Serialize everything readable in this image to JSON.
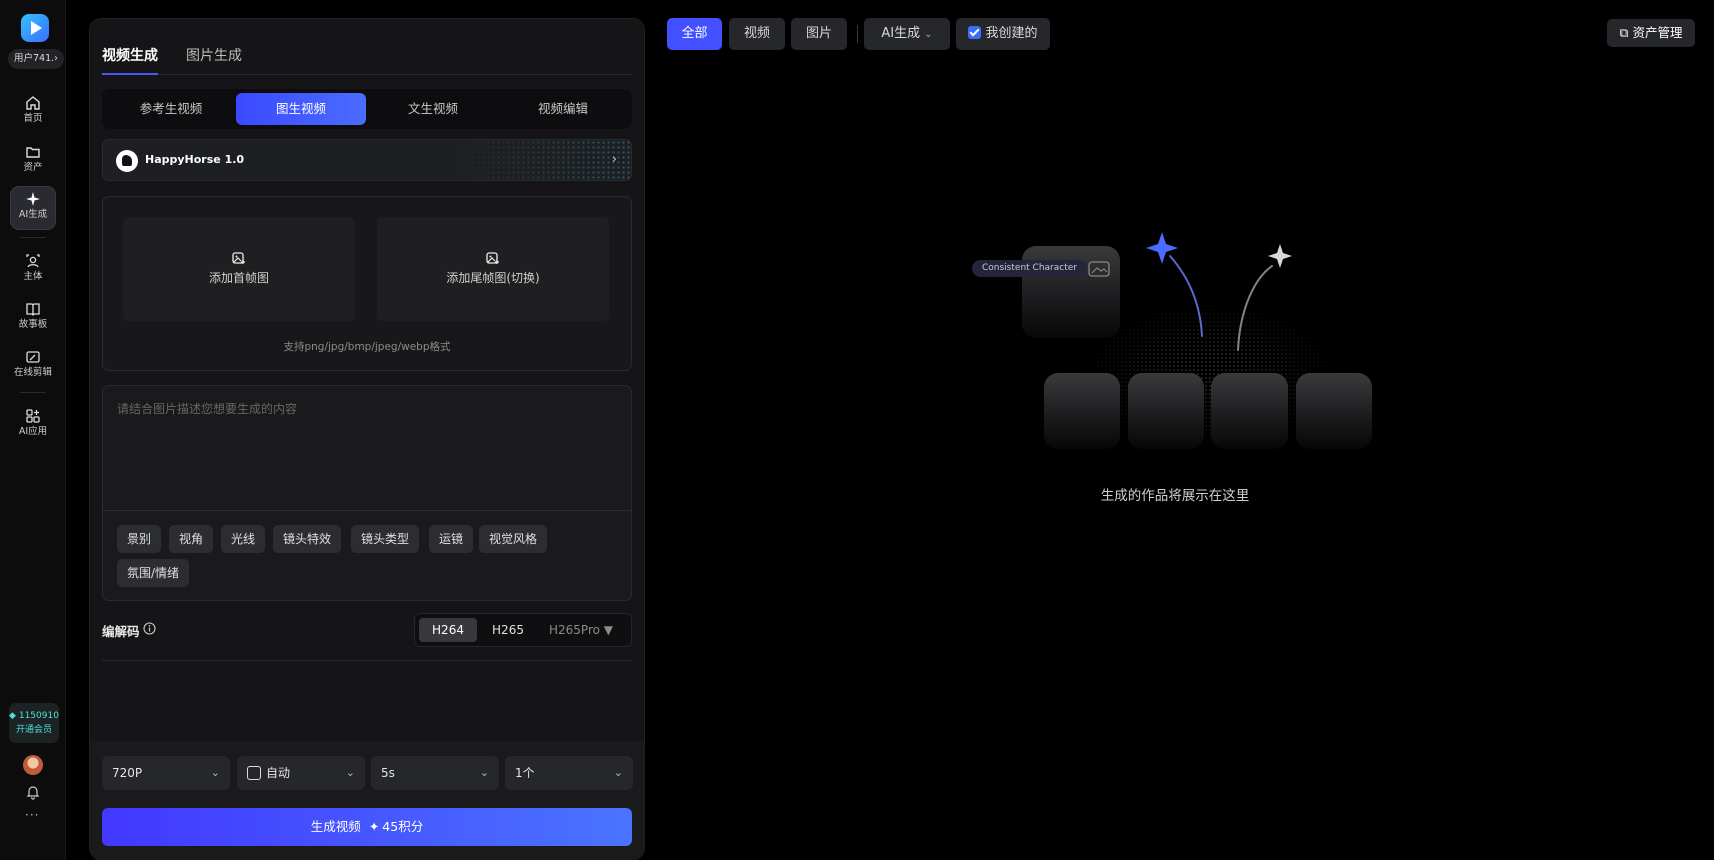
{
  "rail": {
    "user": "用户741.",
    "nav": [
      {
        "label": "首页",
        "icon": "home-icon"
      },
      {
        "label": "资产",
        "icon": "folder-icon"
      },
      {
        "label": "AI生成",
        "icon": "sparkle-icon"
      },
      {
        "label": "主体",
        "icon": "subject-icon"
      },
      {
        "label": "故事板",
        "icon": "book-icon"
      },
      {
        "label": "在线剪辑",
        "icon": "edit-icon"
      },
      {
        "label": "AI应用",
        "icon": "apps-icon"
      }
    ],
    "credits": "1150910",
    "vip_label": "开通会员",
    "more": "···"
  },
  "panel": {
    "top_tabs": [
      "视频生成",
      "图片生成"
    ],
    "mode_tabs": [
      "参考生视频",
      "图生视频",
      "文生视频",
      "视频编辑"
    ],
    "active_mode": "图生视频",
    "model": "HappyHorse 1.0",
    "upload": {
      "first_frame": "添加首帧图",
      "last_frame": "添加尾帧图(切换)",
      "hint": "支持png/jpg/bmp/jpeg/webp格式"
    },
    "prompt": {
      "placeholder": "请结合图片描述您想要生成的内容",
      "value": ""
    },
    "chips": [
      "景别",
      "视角",
      "光线",
      "镜头特效",
      "镜头类型",
      "运镜",
      "视觉风格",
      "氛围/情绪"
    ],
    "codec": {
      "label": "编解码",
      "options": [
        "H264",
        "H265",
        "H265Pro"
      ],
      "selected": "H264"
    },
    "settings": {
      "resolution": "720P",
      "aspect": "自动",
      "duration": "5s",
      "count": "1个"
    },
    "generate": {
      "label": "生成视频",
      "cost": "45积分"
    }
  },
  "gallery": {
    "filters": [
      "全部",
      "视频",
      "图片"
    ],
    "active_filter": "全部",
    "ai_dropdown": "AI生成",
    "mine_checkbox": "我创建的",
    "asset_button": "资产管理",
    "illustration_pill": "Consistent Character",
    "empty_text": "生成的作品将展示在这里"
  },
  "colors": {
    "accent": "#4250ff",
    "credit": "#4fe0d3"
  }
}
